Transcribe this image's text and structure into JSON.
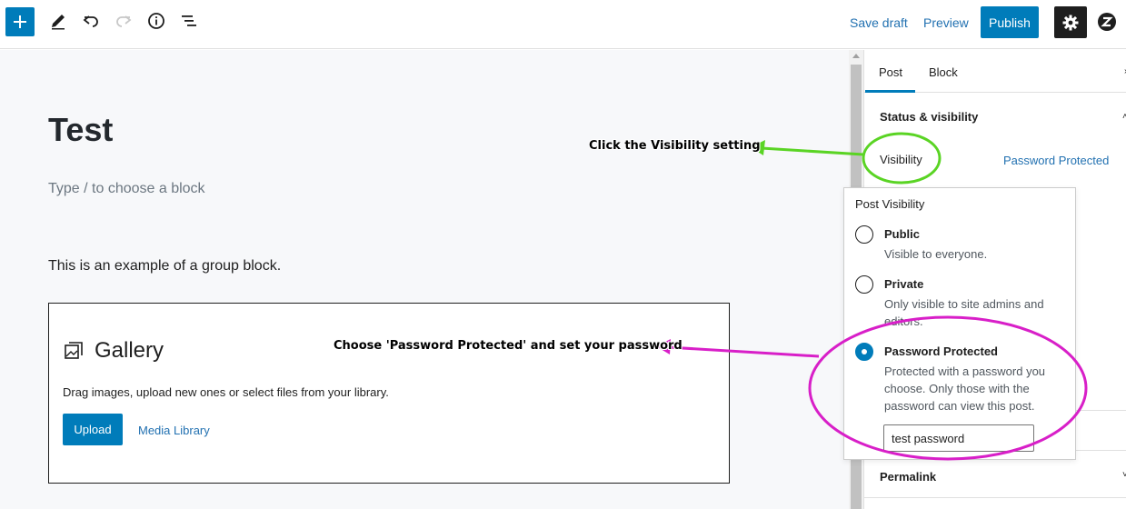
{
  "toolbar": {
    "icons": [
      "plus-icon",
      "pencil-icon",
      "undo-icon",
      "redo-icon",
      "info-icon",
      "list-view-icon",
      "gear-icon",
      "plugin-logo-icon"
    ],
    "save_draft_label": "Save draft",
    "preview_label": "Preview",
    "publish_label": "Publish"
  },
  "editor": {
    "title": "Test",
    "block_placeholder": "Type / to choose a block",
    "group_text": "This is an example of a group block.",
    "gallery": {
      "title": "Gallery",
      "description": "Drag images, upload new ones or select files from your library.",
      "upload_label": "Upload",
      "media_library_label": "Media Library"
    }
  },
  "sidebar": {
    "tabs": [
      {
        "label": "Post",
        "active": true
      },
      {
        "label": "Block",
        "active": false
      }
    ],
    "status_panel_title": "Status & visibility",
    "visibility_label": "Visibility",
    "visibility_value": "Password Protected",
    "permalink_title": "Permalink"
  },
  "popover": {
    "title": "Post Visibility",
    "options": [
      {
        "label": "Public",
        "description": "Visible to everyone.",
        "checked": false
      },
      {
        "label": "Private",
        "description": "Only visible to site admins and editors.",
        "checked": false
      },
      {
        "label": "Password Protected",
        "description": "Protected with a password you choose. Only those with the password can view this post.",
        "checked": true
      }
    ],
    "password_value": "test password"
  },
  "annotations": {
    "visibility_hint": "Click the Visibility setting",
    "password_hint": "Choose 'Password Protected' and set your password",
    "green_color": "#5ad424",
    "magenta_color": "#d81fc8"
  },
  "colors": {
    "accent": "#007cba",
    "link": "#2271b1"
  }
}
